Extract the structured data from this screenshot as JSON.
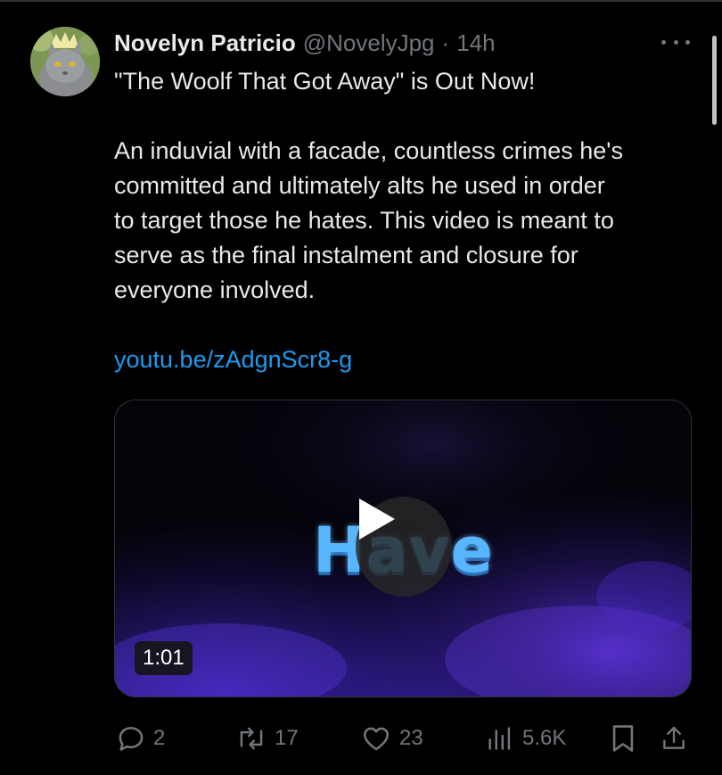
{
  "tweet": {
    "author_name": "Novelyn Patricio",
    "author_handle": "@NovelyJpg",
    "separator": "·",
    "time": "14h",
    "text_line1": "\"The Woolf That Got Away\" is Out Now!",
    "body_lines": [
      "An induvial with a facade, countless crimes he's",
      "committed and ultimately alts he used in order",
      "to target those he hates. This video is meant to",
      "serve as the final instalment and closure for",
      "everyone involved."
    ],
    "link": "youtu.be/zAdgnScr8-g"
  },
  "media": {
    "video_title_text": "Have",
    "duration": "1:01"
  },
  "actions": {
    "replies": "2",
    "reposts": "17",
    "likes": "23",
    "views": "5.6K"
  },
  "icons": [
    "more-icon",
    "reply-icon",
    "repost-icon",
    "like-icon",
    "views-icon",
    "bookmark-icon",
    "share-icon",
    "play-icon"
  ],
  "colors": {
    "background": "#000000",
    "text": "#e7e9ea",
    "muted": "#71767b",
    "link": "#1d9bf0"
  }
}
